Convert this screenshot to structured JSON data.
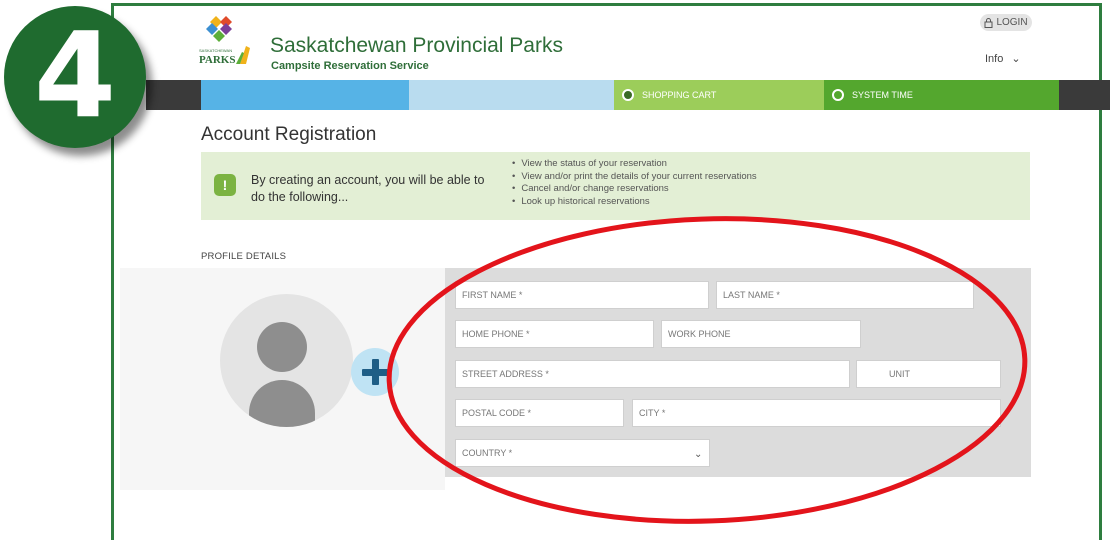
{
  "step_number": "4",
  "header": {
    "title": "Saskatchewan Provincial Parks",
    "subtitle": "Campsite Reservation Service",
    "login_label": "LOGIN",
    "info_label": "Info"
  },
  "logo": {
    "small_text": "SASKATCHEWAN",
    "brand": "PARKS"
  },
  "navbar": {
    "cart_label": "SHOPPING CART",
    "time_label": "SYSTEM TIME"
  },
  "page": {
    "title": "Account Registration",
    "info_text": "By creating an account, you will be able to do the following...",
    "benefits": [
      "View the status of your reservation",
      "View and/or print the details of your current reservations",
      "Cancel and/or change reservations",
      "Look up historical reservations"
    ],
    "section_label": "PROFILE DETAILS"
  },
  "form": {
    "first_name": "FIRST NAME *",
    "last_name": "LAST NAME *",
    "home_phone": "HOME PHONE *",
    "work_phone": "WORK PHONE",
    "street_address": "STREET ADDRESS *",
    "unit": "UNIT",
    "postal_code": "POSTAL CODE *",
    "city": "CITY *",
    "country": "COUNTRY *"
  },
  "colors": {
    "brand_green": "#2f6e39",
    "annotation_red": "#e3141b",
    "nav_blue": "#56b3e6",
    "nav_light_blue": "#b9dcef",
    "nav_light_green": "#9ccd5a",
    "nav_green": "#54a72e"
  }
}
